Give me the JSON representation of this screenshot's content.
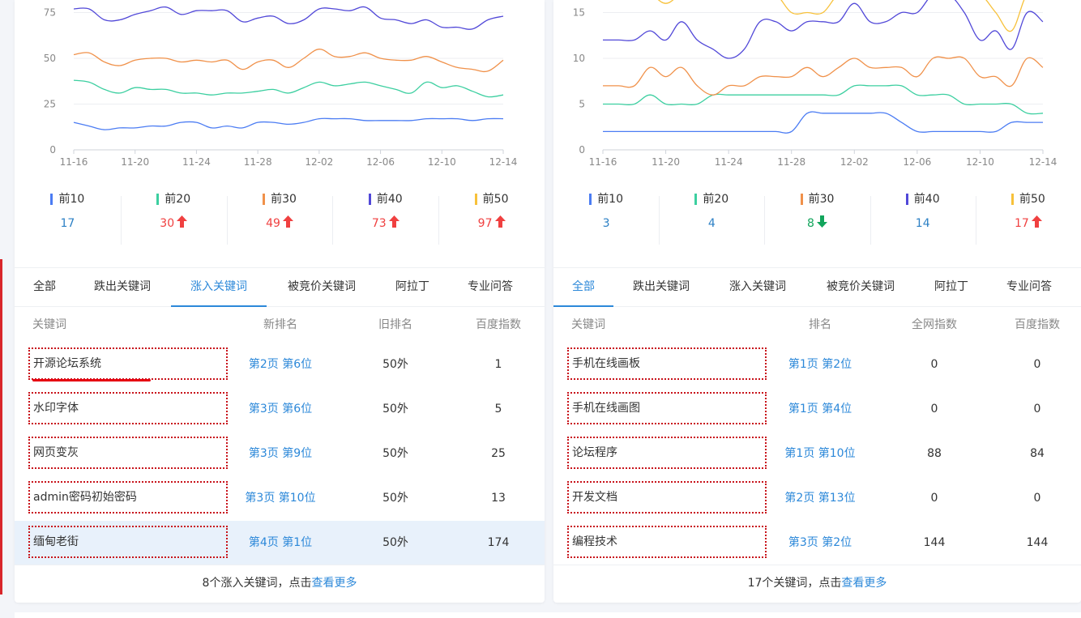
{
  "colors": {
    "top10": "#4b7cf3",
    "top20": "#3ccfa0",
    "top30": "#f0914a",
    "top40": "#5148d8",
    "top50": "#f7c13a",
    "link": "#2c88d9",
    "up": "#f04040",
    "down": "#12a55c"
  },
  "left": {
    "chart_data": {
      "type": "line",
      "x": [
        "11-16",
        "11-17",
        "11-18",
        "11-19",
        "11-20",
        "11-21",
        "11-22",
        "11-23",
        "11-24",
        "11-25",
        "11-26",
        "11-27",
        "11-28",
        "11-29",
        "11-30",
        "12-01",
        "12-02",
        "12-03",
        "12-04",
        "12-05",
        "12-06",
        "12-07",
        "12-08",
        "12-09",
        "12-10",
        "12-11",
        "12-12",
        "12-13",
        "12-14"
      ],
      "x_ticks": [
        "11-16",
        "11-20",
        "11-24",
        "11-28",
        "12-02",
        "12-06",
        "12-10",
        "12-14"
      ],
      "y_ticks": [
        0,
        25,
        50,
        75
      ],
      "ylim": [
        0,
        78
      ],
      "grid": true,
      "series": [
        {
          "name": "前10",
          "color": "#4b7cf3",
          "values": [
            15,
            13,
            11,
            12,
            12,
            13,
            13,
            15,
            15,
            12,
            13,
            12,
            15,
            15,
            14,
            15,
            17,
            17,
            17,
            16,
            16,
            16,
            16,
            17,
            17,
            17,
            16,
            17,
            17
          ]
        },
        {
          "name": "前20",
          "color": "#3ccfa0",
          "values": [
            38,
            37,
            33,
            31,
            34,
            33,
            33,
            31,
            31,
            30,
            31,
            31,
            32,
            33,
            31,
            34,
            37,
            35,
            36,
            37,
            35,
            33,
            31,
            37,
            34,
            35,
            32,
            29,
            30
          ]
        },
        {
          "name": "前30",
          "color": "#f0914a",
          "values": [
            52,
            53,
            48,
            46,
            49,
            50,
            50,
            48,
            49,
            48,
            49,
            44,
            48,
            49,
            45,
            50,
            55,
            51,
            51,
            53,
            50,
            49,
            49,
            51,
            48,
            45,
            44,
            43,
            49
          ]
        },
        {
          "name": "前40",
          "color": "#5148d8",
          "values": [
            77,
            77,
            71,
            71,
            74,
            76,
            78,
            74,
            76,
            76,
            76,
            70,
            72,
            73,
            69,
            71,
            77,
            77,
            76,
            78,
            72,
            71,
            69,
            71,
            67,
            67,
            66,
            71,
            73
          ]
        }
      ]
    },
    "stats": [
      {
        "label": "前10",
        "value": "17",
        "trend": "none"
      },
      {
        "label": "前20",
        "value": "30",
        "trend": "up"
      },
      {
        "label": "前30",
        "value": "49",
        "trend": "up"
      },
      {
        "label": "前40",
        "value": "73",
        "trend": "up"
      },
      {
        "label": "前50",
        "value": "97",
        "trend": "up"
      }
    ],
    "tabs": [
      "全部",
      "跌出关键词",
      "涨入关键词",
      "被竞价关键词",
      "阿拉丁",
      "专业问答"
    ],
    "active_tab": 2,
    "headers": [
      "关键词",
      "新排名",
      "旧排名",
      "百度指数"
    ],
    "rows": [
      {
        "keyword": "开源论坛系统",
        "rank": "第2页 第6位",
        "old": "50外",
        "index": "1"
      },
      {
        "keyword": "水印字体",
        "rank": "第3页 第6位",
        "old": "50外",
        "index": "5"
      },
      {
        "keyword": "网页变灰",
        "rank": "第3页 第9位",
        "old": "50外",
        "index": "25"
      },
      {
        "keyword": "admin密码初始密码",
        "rank": "第3页 第10位",
        "old": "50外",
        "index": "13"
      },
      {
        "keyword": "缅甸老街",
        "rank": "第4页 第1位",
        "old": "50外",
        "index": "174"
      }
    ],
    "footer": {
      "text": "8个涨入关键词，点击",
      "link": "查看更多"
    }
  },
  "right": {
    "chart_data": {
      "type": "line",
      "x": [
        "11-16",
        "11-17",
        "11-18",
        "11-19",
        "11-20",
        "11-21",
        "11-22",
        "11-23",
        "11-24",
        "11-25",
        "11-26",
        "11-27",
        "11-28",
        "11-29",
        "11-30",
        "12-01",
        "12-02",
        "12-03",
        "12-04",
        "12-05",
        "12-06",
        "12-07",
        "12-08",
        "12-09",
        "12-10",
        "12-11",
        "12-12",
        "12-13",
        "12-14"
      ],
      "x_ticks": [
        "11-16",
        "11-20",
        "11-24",
        "11-28",
        "12-02",
        "12-06",
        "12-10",
        "12-14"
      ],
      "y_ticks": [
        0,
        5,
        10,
        15
      ],
      "ylim": [
        0,
        16
      ],
      "grid": true,
      "series": [
        {
          "name": "前10",
          "color": "#4b7cf3",
          "values": [
            2,
            2,
            2,
            2,
            2,
            2,
            2,
            2,
            2,
            2,
            2,
            2,
            2,
            4,
            4,
            4,
            4,
            4,
            4,
            3,
            2,
            2,
            2,
            2,
            2,
            2,
            3,
            3,
            3
          ]
        },
        {
          "name": "前20",
          "color": "#3ccfa0",
          "values": [
            5,
            5,
            5,
            6,
            5,
            5,
            5,
            6,
            6,
            6,
            6,
            6,
            6,
            6,
            6,
            6,
            7,
            7,
            7,
            7,
            6,
            6,
            6,
            5,
            5,
            5,
            5,
            4,
            4
          ]
        },
        {
          "name": "前30",
          "color": "#f0914a",
          "values": [
            7,
            7,
            7,
            9,
            8,
            9,
            7,
            6,
            7,
            7,
            8,
            8,
            8,
            9,
            8,
            9,
            10,
            9,
            9,
            9,
            8,
            10,
            10,
            10,
            8,
            8,
            7,
            10,
            9
          ]
        },
        {
          "name": "前40",
          "color": "#5148d8",
          "values": [
            12,
            12,
            12,
            13,
            12,
            14,
            12,
            11,
            10,
            11,
            14,
            14,
            13,
            14,
            14,
            14,
            16,
            14,
            14,
            15,
            15,
            17,
            17,
            15,
            12,
            13,
            11,
            15,
            14
          ]
        },
        {
          "name": "前50",
          "color": "#f7c13a",
          "values": [
            17,
            17,
            17,
            17,
            16,
            17,
            17,
            17,
            17,
            17,
            17,
            17,
            15,
            15,
            15,
            17,
            17,
            17,
            17,
            17,
            17,
            17,
            17,
            17,
            17,
            15,
            13,
            17,
            17
          ]
        }
      ]
    },
    "stats": [
      {
        "label": "前10",
        "value": "3",
        "trend": "none"
      },
      {
        "label": "前20",
        "value": "4",
        "trend": "none"
      },
      {
        "label": "前30",
        "value": "8",
        "trend": "down"
      },
      {
        "label": "前40",
        "value": "14",
        "trend": "none"
      },
      {
        "label": "前50",
        "value": "17",
        "trend": "up"
      }
    ],
    "tabs": [
      "全部",
      "跌出关键词",
      "涨入关键词",
      "被竞价关键词",
      "阿拉丁",
      "专业问答"
    ],
    "active_tab": 0,
    "headers": [
      "关键词",
      "排名",
      "全网指数",
      "百度指数"
    ],
    "rows": [
      {
        "keyword": "手机在线画板",
        "rank": "第1页 第2位",
        "old": "0",
        "index": "0"
      },
      {
        "keyword": "手机在线画图",
        "rank": "第1页 第4位",
        "old": "0",
        "index": "0"
      },
      {
        "keyword": "论坛程序",
        "rank": "第1页 第10位",
        "old": "88",
        "index": "84"
      },
      {
        "keyword": "开发文档",
        "rank": "第2页 第13位",
        "old": "0",
        "index": "0"
      },
      {
        "keyword": "编程技术",
        "rank": "第3页 第2位",
        "old": "144",
        "index": "144"
      }
    ],
    "footer": {
      "text": "17个关键词，点击",
      "link": "查看更多"
    }
  }
}
